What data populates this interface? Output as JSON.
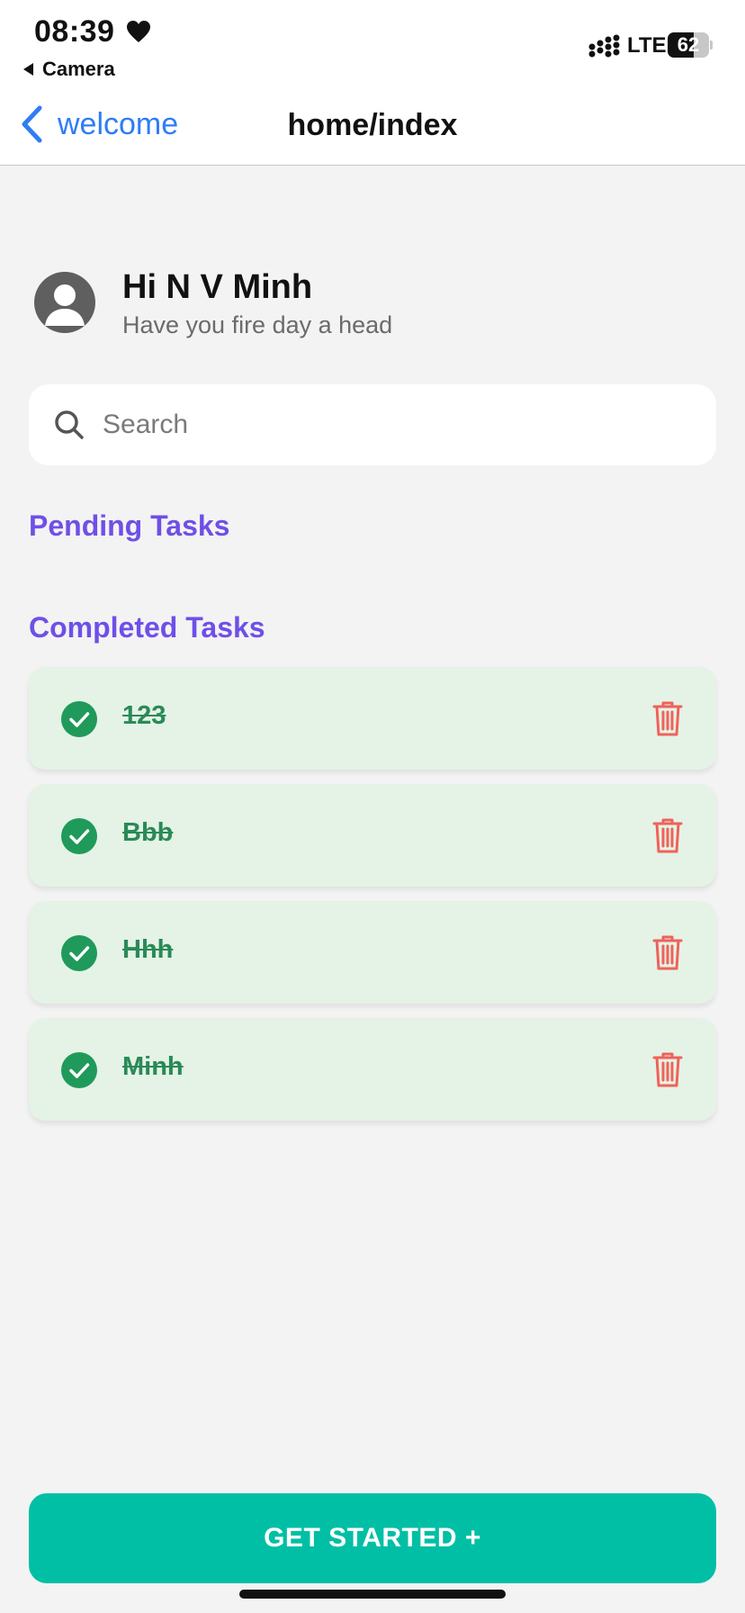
{
  "status_bar": {
    "time": "08:39",
    "back_app": "Camera",
    "network": "LTE",
    "battery": "62",
    "battery_level": 0.62
  },
  "nav": {
    "back_label": "welcome",
    "title": "home/index"
  },
  "profile": {
    "greeting": "Hi N V Minh",
    "subtitle": "Have you fire day a head"
  },
  "search": {
    "placeholder": "Search",
    "value": ""
  },
  "sections": {
    "pending_title": "Pending Tasks",
    "completed_title": "Completed Tasks"
  },
  "completed_tasks": [
    {
      "text": "123",
      "done": true
    },
    {
      "text": "Bbb",
      "done": true
    },
    {
      "text": "Hhh",
      "done": true
    },
    {
      "text": "Minh",
      "done": true
    }
  ],
  "colors": {
    "accent": "#6f4fe8",
    "primary_button": "#00bfa5",
    "check": "#1f9a5a",
    "delete": "#f0625a",
    "task_bg": "#e4f3e6",
    "link": "#2f7cf6"
  },
  "icons": {
    "nav_back": "chevron-left-icon",
    "search": "search-icon",
    "avatar": "person-avatar-icon",
    "task_check": "check-circle-icon",
    "task_delete": "trash-icon"
  },
  "footer": {
    "button_label": "GET STARTED +"
  }
}
